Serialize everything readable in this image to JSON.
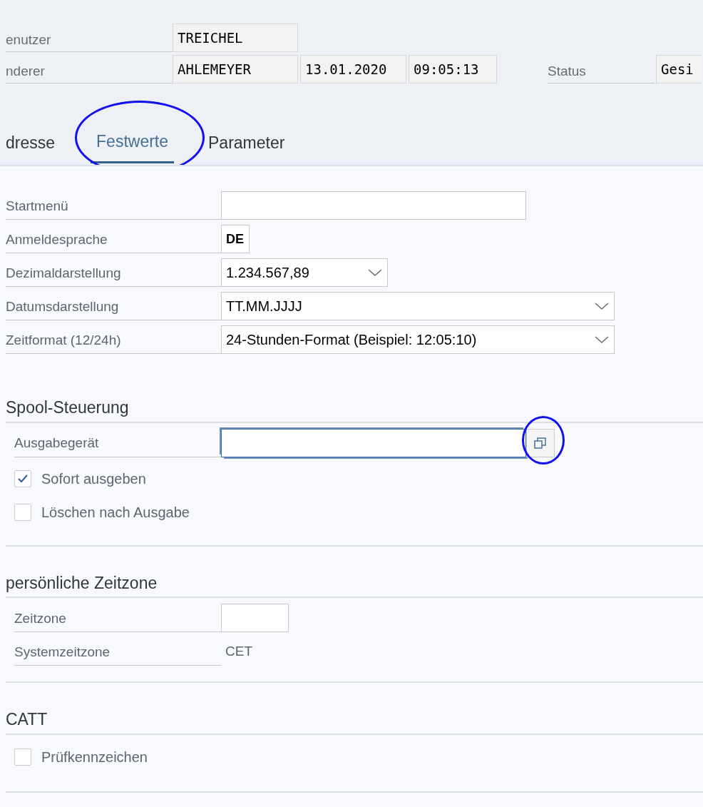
{
  "header": {
    "rows": [
      {
        "label": "enutzer",
        "fields": [
          "TREICHEL"
        ]
      },
      {
        "label": "nderer",
        "fields": [
          "AHLEMEYER",
          "13.01.2020",
          "09:05:13"
        ],
        "status": {
          "label": "Status",
          "value": "Gesi"
        }
      }
    ]
  },
  "tabs": [
    {
      "label": "dresse",
      "selected": false
    },
    {
      "label": "Festwerte",
      "selected": true
    },
    {
      "label": "Parameter",
      "selected": false
    }
  ],
  "fields": [
    {
      "kind": "input",
      "label": "Startmenü"
    },
    {
      "kind": "input",
      "label": "Anmeldesprache",
      "value": "DE"
    },
    {
      "kind": "select",
      "label": "Dezimaldarstellung",
      "value": "1.234.567,89"
    },
    {
      "kind": "select",
      "label": "Datumsdarstellung",
      "value": "TT.MM.JJJJ"
    },
    {
      "kind": "select",
      "label": "Zeitformat (12/24h)",
      "value": "24-Stunden-Format (Beispiel: 12:05:10)"
    }
  ],
  "sections": [
    {
      "title": "Spool-Steuerung",
      "items": [
        {
          "kind": "value-help",
          "label": "Ausgabegerät",
          "focused": true
        },
        {
          "kind": "checkbox",
          "label": "Sofort ausgeben",
          "checked": true
        },
        {
          "kind": "checkbox",
          "label": "Löschen nach Ausgabe",
          "checked": false
        }
      ]
    },
    {
      "title": "persönliche Zeitzone",
      "items": [
        {
          "kind": "input",
          "label": "Zeitzone"
        },
        {
          "kind": "text",
          "label": "Systemzeitzone",
          "value": "CET"
        }
      ]
    },
    {
      "title": "CATT",
      "items": [
        {
          "kind": "checkbox",
          "label": "Prüfkennzeichen",
          "checked": false
        }
      ]
    }
  ]
}
